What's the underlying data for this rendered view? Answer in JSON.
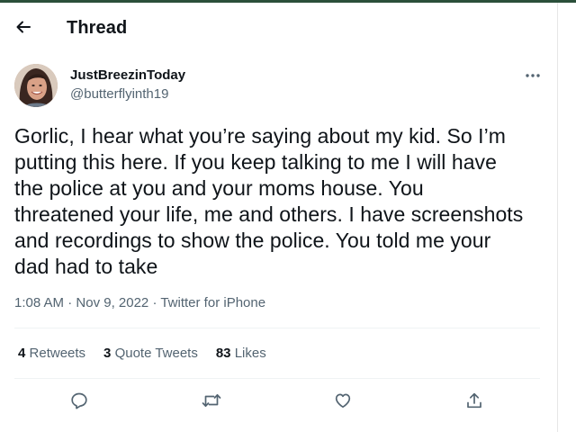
{
  "header": {
    "title": "Thread",
    "back_icon": "arrow-left-icon"
  },
  "author": {
    "name": "JustBreezinToday",
    "handle": "@butterflyinth19",
    "avatar_icon": "avatar-photo"
  },
  "tweet": {
    "text": "Gorlic, I hear what you’re saying about my kid. So I’m\nputting this here. If you keep talking to me I will have\nthe police at you and your moms house. You\nthreatened your life, me and others. I have screenshots\nand recordings to show the police. You told me your\ndad had to take",
    "time": "1:08 AM",
    "date": "Nov 9, 2022",
    "source": "Twitter for iPhone",
    "separator": " · "
  },
  "stats": {
    "retweets_count": "4",
    "retweets_label": "Retweets",
    "quotes_count": "3",
    "quotes_label": "Quote Tweets",
    "likes_count": "83",
    "likes_label": "Likes"
  },
  "actions": [
    "reply-icon",
    "retweet-icon",
    "like-icon",
    "share-icon"
  ],
  "colors": {
    "text": "#0f1419",
    "secondary": "#536471",
    "divider": "#eff3f4",
    "top_accent": "#2b4f3a"
  }
}
